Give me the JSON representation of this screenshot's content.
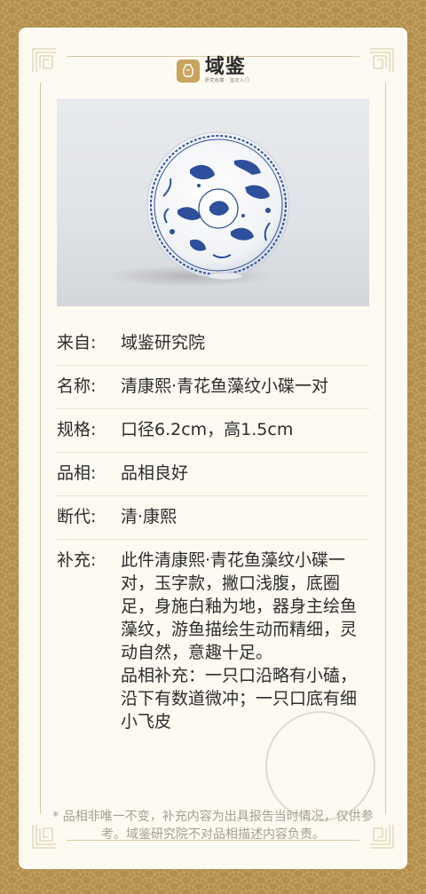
{
  "brand": {
    "name": "域鉴",
    "tagline": "研究收藏 · 鉴定入门",
    "icon": "vase-logo-icon",
    "color": "#c9a45e"
  },
  "photo": {
    "subject": "blue-and-white porcelain dish with fish and algae decoration"
  },
  "fields": [
    {
      "label": "来自:",
      "value": "域鉴研究院"
    },
    {
      "label": "名称:",
      "value": "清康熙·青花鱼藻纹小碟一对"
    },
    {
      "label": "规格:",
      "value": "口径6.2cm，高1.5cm"
    },
    {
      "label": "品相:",
      "value": "品相良好"
    },
    {
      "label": "断代:",
      "value": "清·康熙"
    },
    {
      "label": "补充:",
      "value": "此件清康熙·青花鱼藻纹小碟一对，玉字款，撇口浅腹，底圈足，身施白釉为地，器身主绘鱼藻纹，游鱼描绘生动而精细，灵动自然，意趣十足。",
      "value2": "品相补充：一只口沿略有小磕，沿下有数道微冲；一只口底有细小飞皮"
    }
  ],
  "footnote": "* 品相非唯一不变，补充内容为出具报告当时情况，仅供参考。域鉴研究院不对品相描述内容负责。",
  "colors": {
    "background": "#b38f4e",
    "card": "#fdfaf2",
    "porcelain_blue": "#2d4f9c"
  }
}
